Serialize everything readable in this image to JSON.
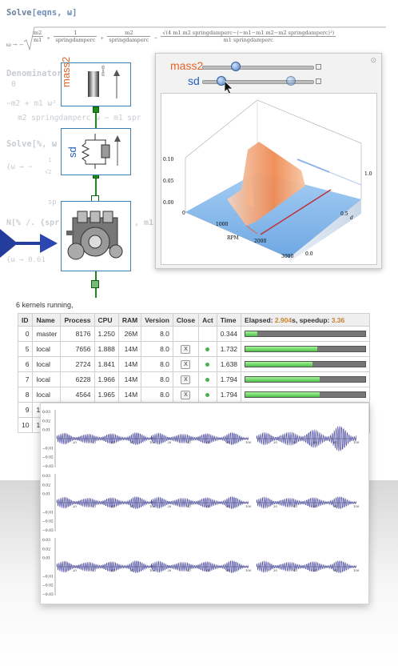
{
  "notebook": {
    "solve_cmd": "Solve",
    "solve_args": "[eqns, ω]",
    "solution_prefix": "ω → −",
    "frac1": {
      "n": "m2",
      "d": "m1"
    },
    "frac2": {
      "n": "1",
      "d": "springdamperc"
    },
    "frac3": {
      "n": "m2",
      "d": "springdamperc"
    },
    "frac4": {
      "n": "√(4 m1 m2 springdamperc−(−m1−m1 m2−m2 springdamperc)²)",
      "d": "m1 springdamperc"
    },
    "denominator_line": "Denominator[ ... ]",
    "zero": "0",
    "m2_line": "−m2 + m1 ω²",
    "m2_line2": "m2 springdamperc ω − m1 spr",
    "solve2": "Solve[%, ω",
    "omega_line": "{ω → −",
    "one": "1",
    "sqrt2": "√2",
    "sp_frag": "sp",
    "n_line": "N[% /. {spr",
    "n_frag": ", m1",
    "omega_val": "{ω → 0.61"
  },
  "diagram": {
    "label_mass2": "mass2",
    "label_sd": "sd",
    "mass_text": "m=m"
  },
  "manipulate": {
    "slider1_label": "mass2",
    "slider2_label": "sd",
    "slider1_value": 0.3,
    "slider2_value": 0.17,
    "slider2_ghost_value": 0.8,
    "plot": {
      "z_ticks": [
        "0.10",
        "0.05",
        "0.00"
      ],
      "rpm_ticks": [
        "1000",
        "2000",
        "3000"
      ],
      "rpm_label": "RPM",
      "d_ticks": [
        "0.0",
        "0.5",
        "1.0"
      ],
      "d_label": "d",
      "zero_tick": "0"
    }
  },
  "kernels": {
    "status": "6 kernels running,",
    "headers": [
      "ID",
      "Name",
      "Process",
      "CPU",
      "RAM",
      "Version",
      "Close",
      "Act",
      "Time"
    ],
    "elapsed_prefix": "Elapsed: ",
    "elapsed_value": "2.904",
    "elapsed_suffix": "s, speedup: ",
    "speedup_value": "3.36",
    "close_label": "X",
    "rows": [
      {
        "id": "0",
        "name": "master",
        "process": "8176",
        "cpu": "1.250",
        "ram": "26M",
        "version": "8.0",
        "time": "0.344",
        "progress": 0.1
      },
      {
        "id": "5",
        "name": "local",
        "process": "7656",
        "cpu": "1.888",
        "ram": "14M",
        "version": "8.0",
        "time": "1.732",
        "progress": 0.6
      },
      {
        "id": "6",
        "name": "local",
        "process": "2724",
        "cpu": "1.841",
        "ram": "14M",
        "version": "8.0",
        "time": "1.638",
        "progress": 0.56
      },
      {
        "id": "7",
        "name": "local",
        "process": "6228",
        "cpu": "1.966",
        "ram": "14M",
        "version": "8.0",
        "time": "1.794",
        "progress": 0.62
      },
      {
        "id": "8",
        "name": "local",
        "process": "4564",
        "cpu": "1.965",
        "ram": "14M",
        "version": "8.0",
        "time": "1.794",
        "progress": 0.62
      },
      {
        "id": "9",
        "name": "19"
      },
      {
        "id": "10",
        "name": "19"
      }
    ]
  },
  "plots_grid": {
    "y_ticks": [
      "0.03",
      "0.02",
      "0.01",
      "−0.01",
      "−0.02",
      "−0.03"
    ],
    "x_ticks": [
      "20",
      "40",
      "60",
      "80",
      "100"
    ],
    "amplitude_growth": [
      [
        1,
        1,
        1.8
      ],
      [
        1,
        1,
        1
      ],
      [
        1,
        1,
        1
      ]
    ],
    "color": "#3a3a9a"
  }
}
